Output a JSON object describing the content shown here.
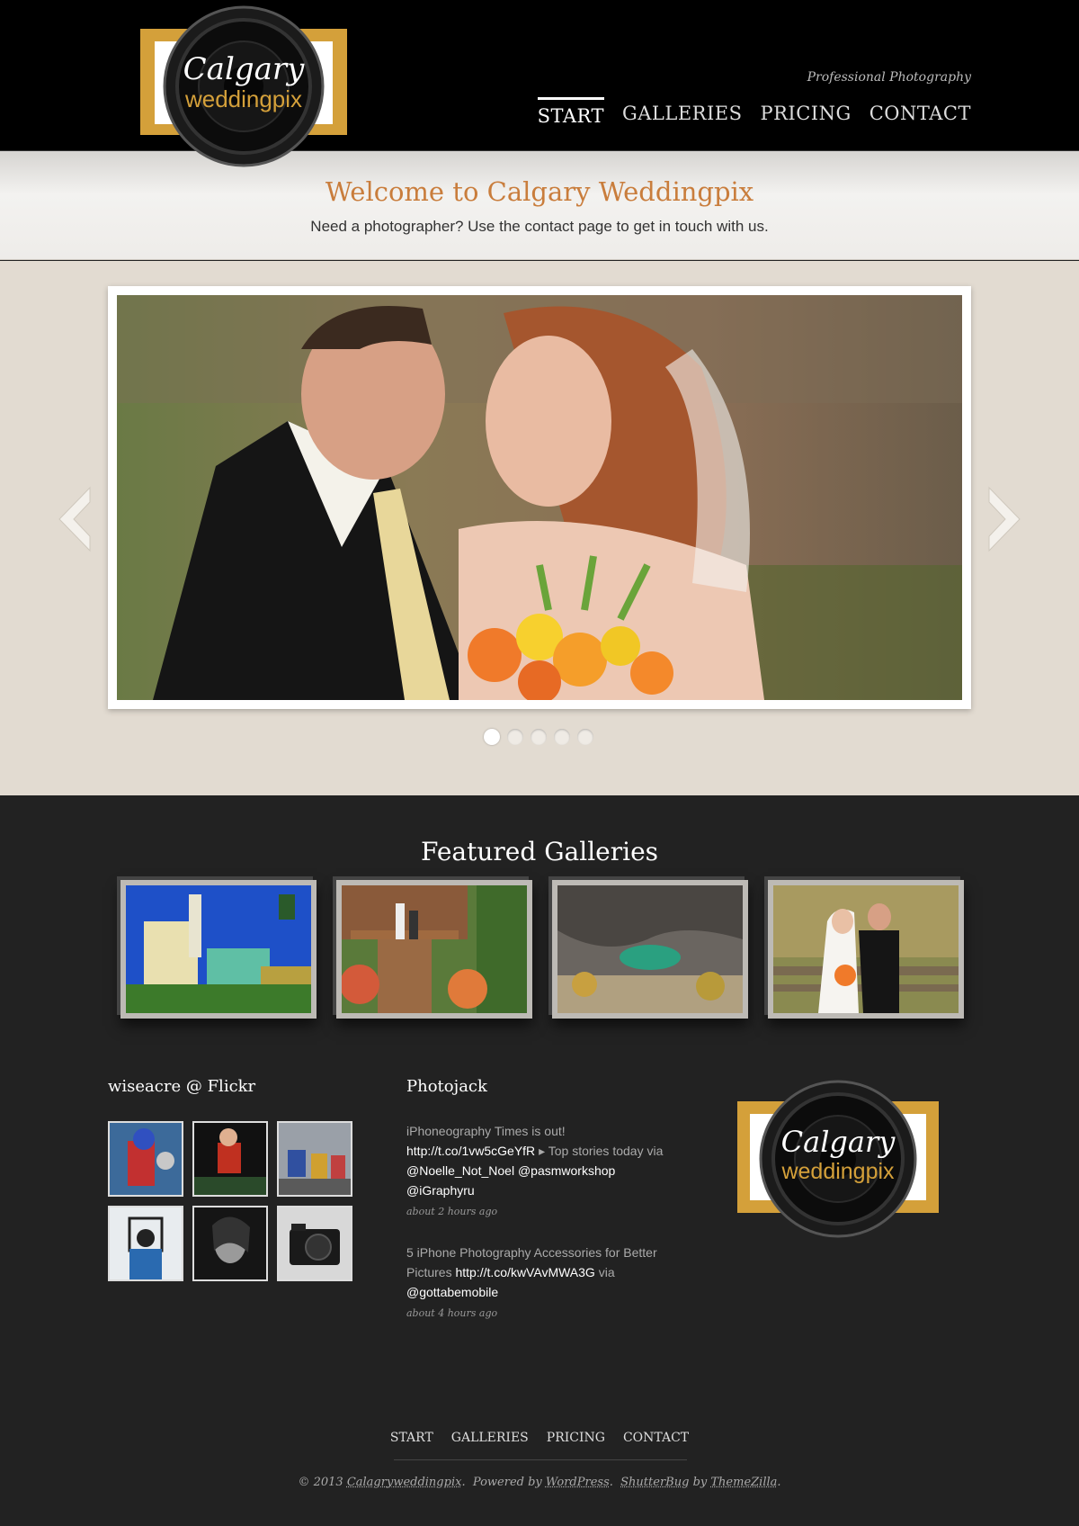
{
  "header": {
    "logo": {
      "line1": "Calgary",
      "line2": "weddingpix"
    },
    "tagline": "Professional Photography",
    "nav": [
      "START",
      "GALLERIES",
      "PRICING",
      "CONTACT"
    ],
    "active_nav": "START"
  },
  "welcome": {
    "title": "Welcome to Calgary Weddingpix",
    "text": "Need a photographer? Use the contact page to get in touch with us."
  },
  "slider": {
    "slide_count": 5,
    "active_slide": 1,
    "current_image": "wedding-couple-kiss-photo"
  },
  "featured": {
    "title": "Featured Galleries",
    "galleries": [
      "city-buildings-photo",
      "family-porch-photo",
      "crater-lake-photo",
      "bride-groom-fence-photo"
    ]
  },
  "flickr": {
    "title": "wiseacre @ Flickr",
    "thumbs": [
      "superhero-kid",
      "kid-red-shirt",
      "kids-playing",
      "person-with-frame",
      "girl-portrait-bw",
      "camera-photo"
    ]
  },
  "photojack": {
    "title": "Photojack",
    "tweets": [
      {
        "text1": "iPhoneography Times is out!",
        "link1": "http://t.co/1vw5cGeYfR",
        "text2": "Top stories today via",
        "link2": "@Noelle_Not_Noel",
        "link3": "@pasmworkshop",
        "link4": "@iGraphyru",
        "time": "about 2 hours ago"
      },
      {
        "text1": "5 iPhone Photography Accessories for Better Pictures",
        "link1": "http://t.co/kwVAvMWA3G",
        "text2": "via",
        "link2": "@gottabemobile",
        "time": "about 4 hours ago"
      }
    ]
  },
  "footer": {
    "nav": [
      "START",
      "GALLERIES",
      "PRICING",
      "CONTACT"
    ],
    "copyright_prefix": "© 2013",
    "site": "Calagryweddingpix",
    "powered": "Powered by",
    "wordpress": "WordPress",
    "theme": "ShutterBug",
    "by": "by",
    "themezilla": "ThemeZilla"
  },
  "colors": {
    "accent": "#c97d3c",
    "logo_gold": "#d4a03a",
    "header_bg": "#000000",
    "body_bg": "#222222"
  }
}
